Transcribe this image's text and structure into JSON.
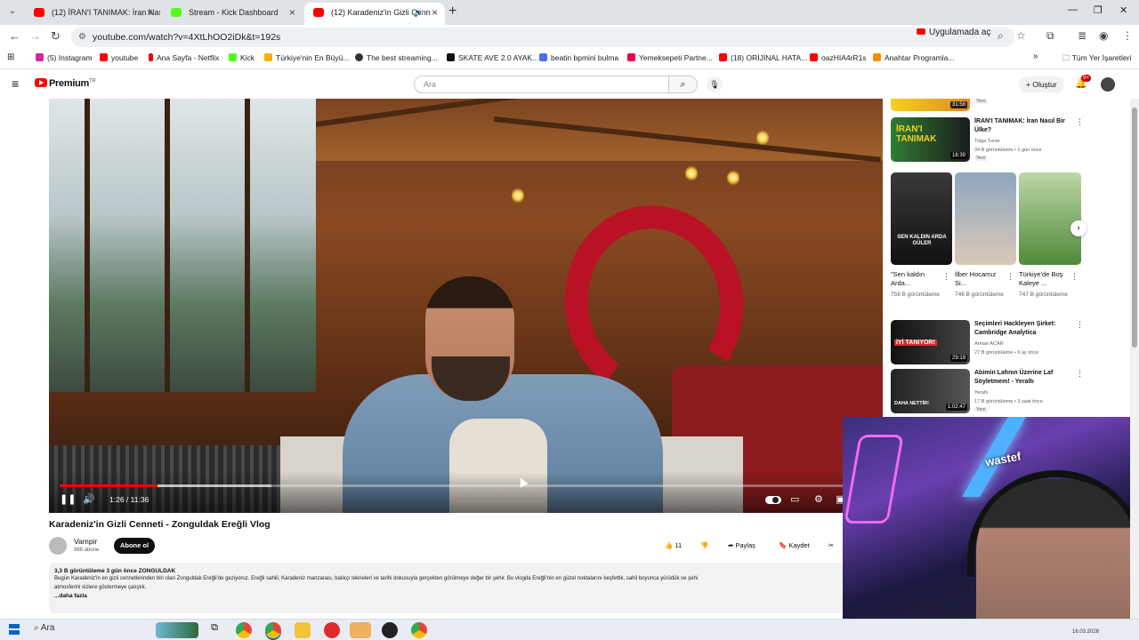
{
  "browser": {
    "tabs": [
      {
        "title": "(12) İRAN'I TANIMAK: İran Nasıl",
        "favicon_color": "#ff0000",
        "active": false
      },
      {
        "title": "Stream - Kick Dashboard",
        "favicon_color": "#53fc18",
        "active": false
      },
      {
        "title": "(12) Karadeniz'in Gizli Cenn",
        "favicon_color": "#ff0000",
        "active": true
      }
    ],
    "url": "youtube.com/watch?v=4XtLhOO2iDk&t=192s",
    "open_in_app_label": "Uygulamada aç",
    "bookmarks": [
      {
        "label": "(5) Instagram",
        "color": "#d6249f"
      },
      {
        "label": "youtube",
        "color": "#ff0000"
      },
      {
        "label": "Ana Sayfa - Netflix",
        "color": "#e50914"
      },
      {
        "label": "Kick",
        "color": "#53fc18"
      },
      {
        "label": "Türkiye'nin En Büyü...",
        "color": "#f4b400"
      },
      {
        "label": "The best streaming...",
        "color": "#333333"
      },
      {
        "label": "SKATE AVE 2.0 AYAK...",
        "color": "#111111"
      },
      {
        "label": "beatin bpmini bulma",
        "color": "#4a6cf7"
      },
      {
        "label": "Yemeksepeti Partne...",
        "color": "#ea004b"
      },
      {
        "label": "(18) ORİJİNAL HATA...",
        "color": "#ff0000"
      },
      {
        "label": "oazHIA4rR1s",
        "color": "#ff0000"
      },
      {
        "label": "Anahtar Programla...",
        "color": "#ff8a00"
      }
    ],
    "all_bookmarks_label": "Tüm Yer İşaretleri"
  },
  "youtube": {
    "logo_text": "Premium",
    "logo_region": "TR",
    "search_placeholder": "Ara",
    "create_label": "Oluştur",
    "notifications_badge": "9+"
  },
  "video": {
    "time": "1:26 / 11:36",
    "played_fraction": 0.125,
    "loaded_fraction": 0.27,
    "title": "Karadeniz'in Gizli Cenneti - Zonguldak Ereğli Vlog",
    "channel": "Vampir",
    "subscribers": "988 abone",
    "subscribe_label": "Abone ol",
    "likes": "11",
    "share_label": "Paylaş",
    "save_label": "Kaydet",
    "description_stats": "3,3 B görüntüleme  3 gün önce  ZONGULDAK",
    "description_line1": "Bugün Karadeniz'in en gizli cennetlerinden biri olan Zonguldak Ereğli'de geziyoruz. Ereğli sahili, Karadeniz manzarası, balıkçı tekneleri ve tarihi dokusuyla gerçekten görülmeye değer bir şehir. Bu vlogda Ereğli'nin en güzel noktalarını keşfettik, sahil boyunca yürüdük ve şehi",
    "description_line2": "atmosferini sizlere göstermeye çalıştık.",
    "more_label": "...daha fazla"
  },
  "sidebar": {
    "top_partial": {
      "duration": "31:58",
      "new_label": "Yeni"
    },
    "videos": [
      {
        "title": "İRAN'I TANIMAK: İran Nasıl Bir Ülke?",
        "channel": "Tolga Turan",
        "meta": "34 B görüntüleme • 1 gün önce",
        "new_label": "Yeni",
        "duration": "18:39",
        "thumb_text": "İRAN'I TANIMAK"
      },
      {
        "title": "Seçimleri Hackleyen Şirket: Cambridge Analytica",
        "channel": "Arman ACAR",
        "meta": "27 B görüntüleme • 6 ay önce",
        "duration": "29:19",
        "thumb_text": "İYİ TANIYOR!"
      },
      {
        "title": "Abimin Lafının Üzerine Laf Söyletmem! - Yeraltı",
        "channel": "Yeraltı",
        "meta": "17 B görüntüleme • 3 saat önce",
        "new_label": "Yeni",
        "duration": "1:02:47",
        "thumb_text": "DAHA NETTİR!"
      }
    ],
    "shorts": [
      {
        "title": "\"Sen kaldın Arda...",
        "views": "758 B görüntüleme",
        "thumb_text": "SEN KALDIN ARDA GÜLER"
      },
      {
        "title": "İlber Hocamız Si...",
        "views": "746 B görüntüleme",
        "thumb_text": ""
      },
      {
        "title": "Türkiye'de Boş Kaleye ...",
        "views": "747 B görüntüleme",
        "thumb_text": ""
      }
    ]
  },
  "webcam": {
    "sign_text": "wastef"
  },
  "taskbar": {
    "search_label": "Ara",
    "date": "16.03.2026"
  }
}
